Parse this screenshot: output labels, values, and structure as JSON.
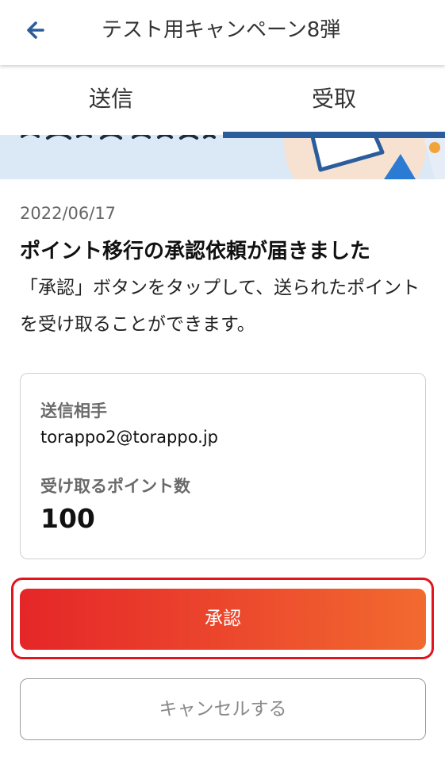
{
  "header": {
    "title": "テスト用キャンペーン8弾",
    "back_icon": "arrow-left-icon",
    "accent_color": "#2b5d9c"
  },
  "tabs": [
    {
      "label": "送信",
      "active": false
    },
    {
      "label": "受取",
      "active": true
    }
  ],
  "message": {
    "date": "2022/06/17",
    "heading": "ポイント移行の承認依頼が届きました",
    "body": "「承認」ボタンをタップして、送られたポイントを受け取ることができます。"
  },
  "details": {
    "sender_label": "送信相手",
    "sender_value": "torappo2@torappo.jp",
    "points_label": "受け取るポイント数",
    "points_value": "100"
  },
  "actions": {
    "approve_label": "承認",
    "cancel_label": "キャンセルする",
    "approve_colors": [
      "#e52628",
      "#f26a2f"
    ]
  }
}
